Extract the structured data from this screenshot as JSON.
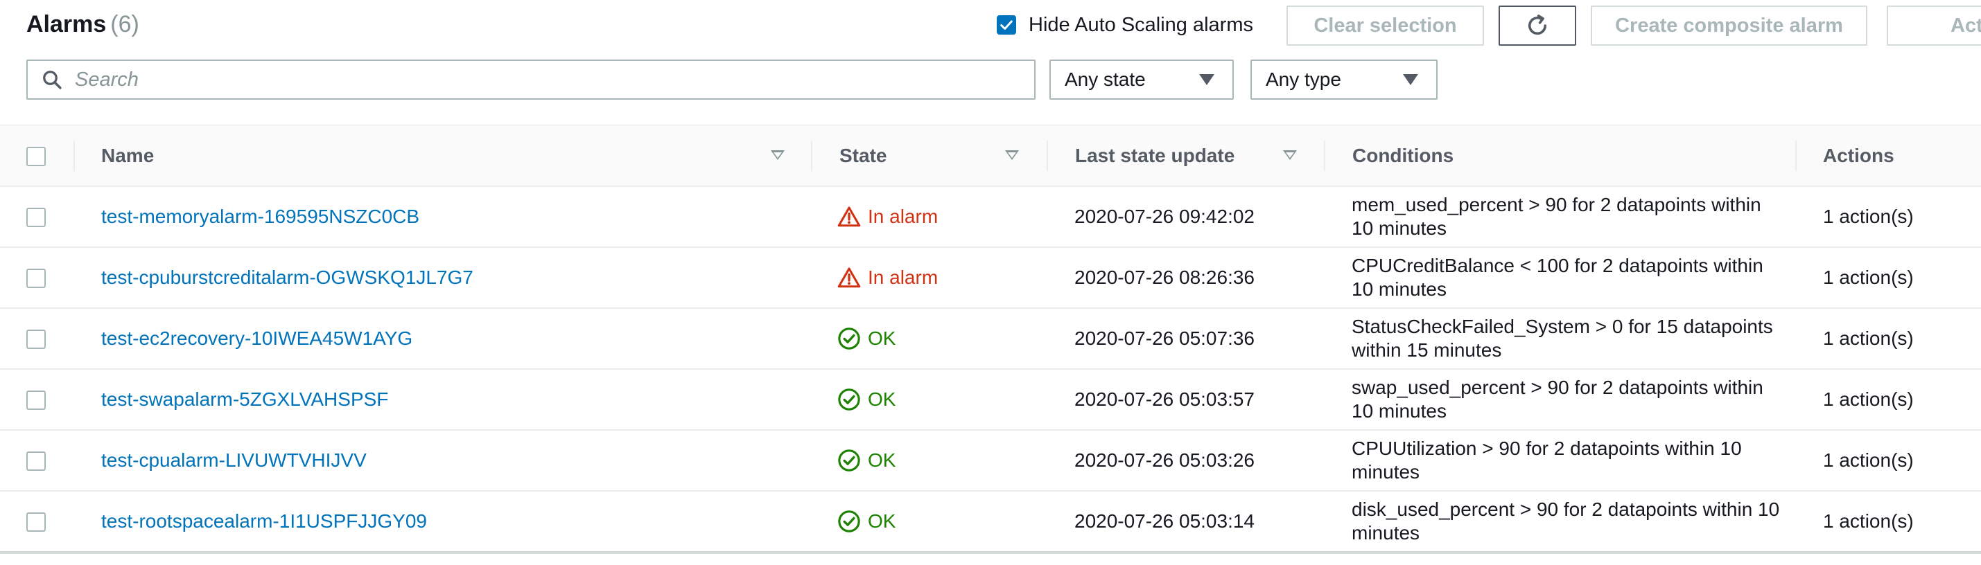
{
  "header": {
    "title": "Alarms",
    "count": "(6)",
    "hide_autoscaling_label": "Hide Auto Scaling alarms",
    "hide_autoscaling_checked": true,
    "clear_selection_label": "Clear selection",
    "refresh_icon": "refresh-icon",
    "create_composite_label": "Create composite alarm",
    "actions_label": "Actions"
  },
  "filters": {
    "search_placeholder": "Search",
    "state_select": "Any state",
    "type_select": "Any type"
  },
  "table": {
    "columns": [
      "Name",
      "State",
      "Last state update",
      "Conditions",
      "Actions"
    ],
    "rows": [
      {
        "name": "test-memoryalarm-169595NSZC0CB",
        "state": "In alarm",
        "state_kind": "alarm",
        "updated": "2020-07-26 09:42:02",
        "conditions": "mem_used_percent > 90 for 2 datapoints within 10 minutes",
        "actions": "1 action(s)"
      },
      {
        "name": "test-cpuburstcreditalarm-OGWSKQ1JL7G7",
        "state": "In alarm",
        "state_kind": "alarm",
        "updated": "2020-07-26 08:26:36",
        "conditions": "CPUCreditBalance < 100 for 2 datapoints within 10 minutes",
        "actions": "1 action(s)"
      },
      {
        "name": "test-ec2recovery-10IWEA45W1AYG",
        "state": "OK",
        "state_kind": "ok",
        "updated": "2020-07-26 05:07:36",
        "conditions": "StatusCheckFailed_System > 0 for 15 datapoints within 15 minutes",
        "actions": "1 action(s)"
      },
      {
        "name": "test-swapalarm-5ZGXLVAHSPSF",
        "state": "OK",
        "state_kind": "ok",
        "updated": "2020-07-26 05:03:57",
        "conditions": "swap_used_percent > 90 for 2 datapoints within 10 minutes",
        "actions": "1 action(s)"
      },
      {
        "name": "test-cpualarm-LIVUWTVHIJVV",
        "state": "OK",
        "state_kind": "ok",
        "updated": "2020-07-26 05:03:26",
        "conditions": "CPUUtilization > 90 for 2 datapoints within 10 minutes",
        "actions": "1 action(s)"
      },
      {
        "name": "test-rootspacealarm-1I1USPFJJGY09",
        "state": "OK",
        "state_kind": "ok",
        "updated": "2020-07-26 05:03:14",
        "conditions": "disk_used_percent > 90 for 2 datapoints within 10 minutes",
        "actions": "1 action(s)"
      }
    ]
  },
  "colors": {
    "link": "#0073bb",
    "alarm": "#d13212",
    "ok": "#1d8102",
    "checkbox_accent": "#0073bb"
  }
}
